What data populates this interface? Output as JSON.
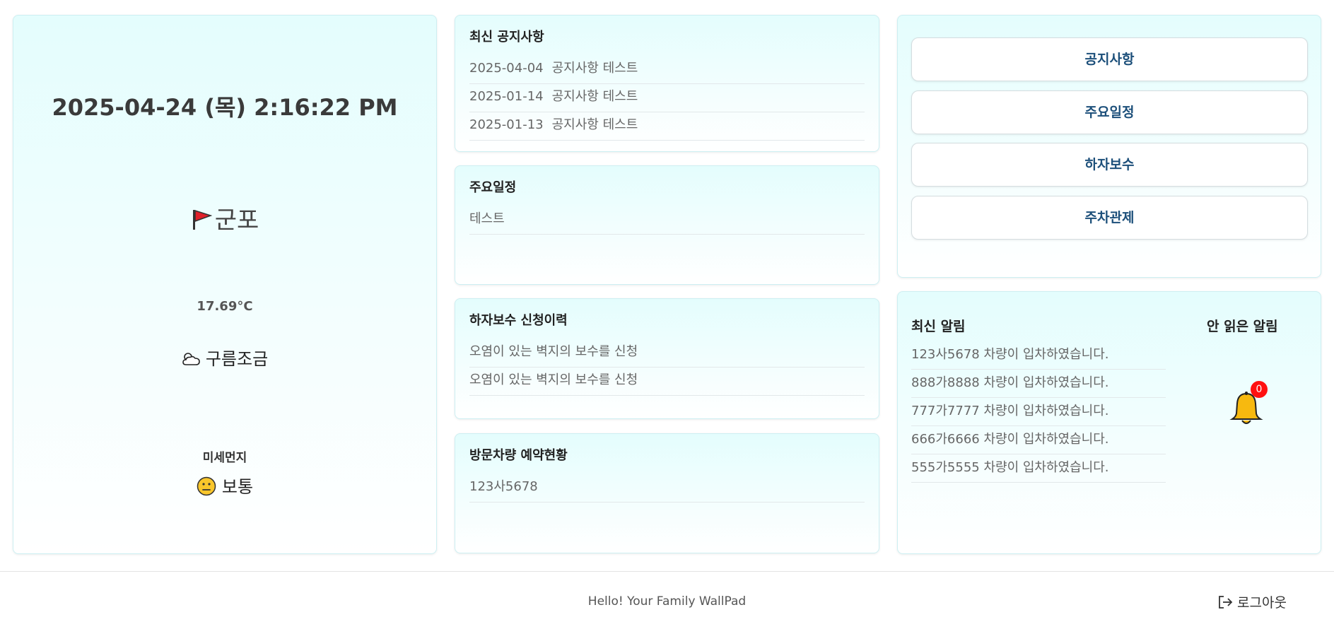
{
  "left": {
    "datetime": "2025-04-24 (목) 2:16:22 PM",
    "location": "군포",
    "temperature": "17.69°C",
    "weather": "구름조금",
    "dust_label": "미세먼지",
    "dust_status": "보통"
  },
  "notice": {
    "title": "최신 공지사항",
    "items": [
      {
        "date": "2025-04-04",
        "text": "공지사항 테스트"
      },
      {
        "date": "2025-01-14",
        "text": "공지사항 테스트"
      },
      {
        "date": "2025-01-13",
        "text": "공지사항 테스트"
      }
    ]
  },
  "schedule": {
    "title": "주요일정",
    "items": [
      "테스트"
    ]
  },
  "repair": {
    "title": "하자보수 신청이력",
    "items": [
      "오염이 있는 벽지의 보수를 신청",
      "오염이 있는 벽지의 보수를 신청"
    ]
  },
  "visitor": {
    "title": "방문차량 예약현황",
    "items": [
      "123사5678"
    ]
  },
  "menu": {
    "notice": "공지사항",
    "schedule": "주요일정",
    "repair": "하자보수",
    "parking": "주차관제"
  },
  "alerts": {
    "title": "최신 알림",
    "items": [
      "123사5678 차량이 입차하였습니다.",
      "888가8888 차량이 입차하였습니다.",
      "777가7777 차량이 입차하였습니다.",
      "666가6666 차량이 입차하였습니다.",
      "555가5555 차량이 입차하였습니다."
    ],
    "unread_title": "안 읽은 알림",
    "unread_count": "0"
  },
  "footer": {
    "text": "Hello! Your Family WallPad",
    "logout": "로그아웃"
  },
  "colors": {
    "card_bg_top": "#e4fdfd",
    "menu_text": "#1c4f7a",
    "badge": "#ff1010",
    "bell": "#f7b90f"
  },
  "icons": {
    "location": "red-flag-icon",
    "weather": "sun-behind-cloud-icon",
    "dust": "neutral-face-icon",
    "alerts": "bell-icon",
    "logout": "logout-icon"
  }
}
